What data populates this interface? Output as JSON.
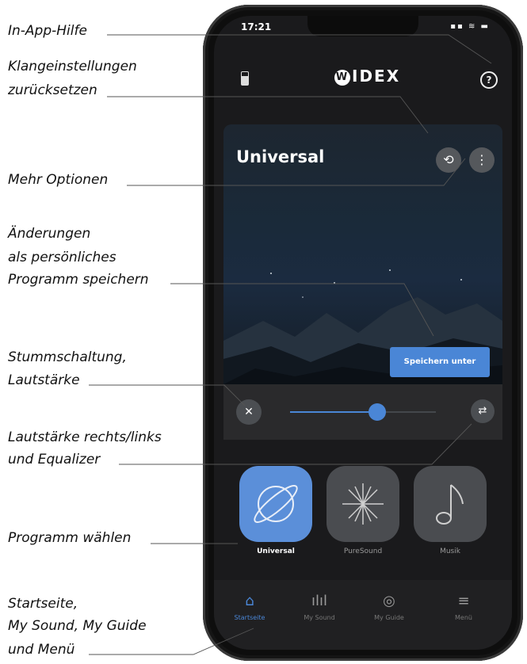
{
  "callouts": {
    "help": "In-App-Hilfe",
    "reset_line1": "Klangeinstellungen",
    "reset_line2": "zurücksetzen",
    "more": "Mehr Optionen",
    "save_line1": "Änderungen",
    "save_line2": "als persönliches",
    "save_line3": "Programm speichern",
    "mute_line1": "Stummschaltung,",
    "mute_line2": "Lautstärke",
    "eq_line1": "Lautstärke rechts/links",
    "eq_line2": "und Equalizer",
    "program": "Programm wählen",
    "nav_line1": "Startseite,",
    "nav_line2": "My Sound, My Guide",
    "nav_line3": "und Menü"
  },
  "status": {
    "time": "17:21",
    "icons": "▪▪ ≋ ▬"
  },
  "header": {
    "brand": "IDEX",
    "brand_mark": "W",
    "help_icon": "?"
  },
  "program": {
    "title": "Universal",
    "save_button": "Speichern unter"
  },
  "volume": {
    "level": 0.6
  },
  "tiles": [
    {
      "label": "Universal",
      "active": true
    },
    {
      "label": "PureSound",
      "active": false
    },
    {
      "label": "Musik",
      "active": false
    }
  ],
  "nav": [
    {
      "label": "Startseite",
      "icon": "home-icon",
      "active": true
    },
    {
      "label": "My Sound",
      "icon": "soundwave-icon",
      "active": false
    },
    {
      "label": "My Guide",
      "icon": "guide-icon",
      "active": false
    },
    {
      "label": "Menü",
      "icon": "menu-icon",
      "active": false
    }
  ],
  "colors": {
    "accent": "#4a86d6",
    "screen_bg": "#1a1a1c"
  }
}
